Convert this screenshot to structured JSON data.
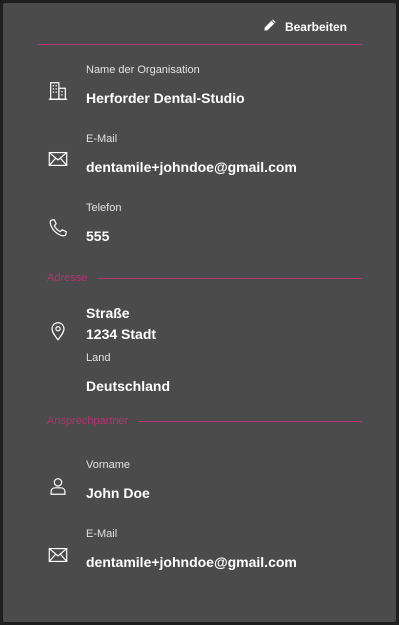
{
  "header": {
    "edit_label": "Bearbeiten"
  },
  "organization": {
    "label": "Name der Organisation",
    "value": "Herforder Dental-Studio",
    "icon": "building-icon"
  },
  "email": {
    "label": "E-Mail",
    "value": "dentamile+johndoe@gmail.com",
    "icon": "envelope-icon"
  },
  "phone": {
    "label": "Telefon",
    "value": "555",
    "icon": "phone-icon"
  },
  "address_section": {
    "title": "Adresse"
  },
  "address": {
    "street": "Straße",
    "city": "1234 Stadt",
    "icon": "location-pin-icon",
    "country_label": "Land",
    "country_value": "Deutschland"
  },
  "contact_section": {
    "title": "Ansprechpartner"
  },
  "contact": {
    "first_name_label": "Vorname",
    "first_name_value": "John Doe",
    "first_name_icon": "person-icon",
    "email_label": "E-Mail",
    "email_value": "dentamile+johndoe@gmail.com",
    "email_icon": "envelope-icon"
  },
  "colors": {
    "panel_background": "#4b4b4b",
    "accent": "#b2336f",
    "text": "#ffffff"
  }
}
